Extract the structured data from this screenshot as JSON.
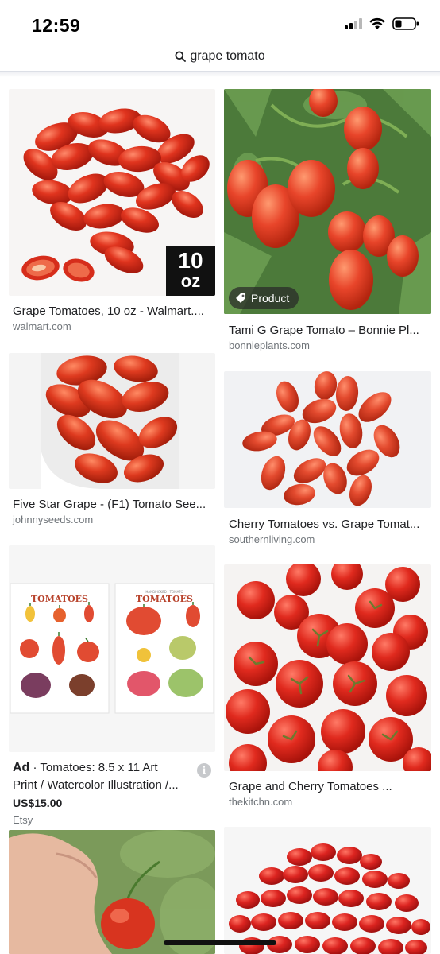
{
  "status_bar": {
    "time": "12:59",
    "battery_level": 0.35
  },
  "search": {
    "query": "grape tomato",
    "icon": "search-icon"
  },
  "results": [
    {
      "title": "Grape Tomatoes, 10 oz - Walmart....",
      "source": "walmart.com",
      "badge": {
        "number": "10",
        "unit": "oz"
      }
    },
    {
      "title": "Tami G Grape Tomato – Bonnie Pl...",
      "source": "bonnieplants.com",
      "chip": "Product",
      "chip_icon": "tag-icon"
    },
    {
      "title": "Five Star Grape - (F1) Tomato See...",
      "source": "johnnyseeds.com"
    },
    {
      "title": "Cherry Tomatoes vs. Grape Tomat...",
      "source": "southernliving.com"
    },
    {
      "title": "Grape and Cherry Tomatoes ...",
      "source": "thekitchn.com"
    }
  ],
  "ad": {
    "label": "Ad",
    "separator": "·",
    "title_line1": "Tomatoes: 8.5 x 11 Art",
    "title_line2": "Print / Watercolor Illustration /...",
    "price": "US$15.00",
    "seller": "Etsy",
    "info_icon": "i",
    "poster_headings": [
      "TOMATOES",
      "TOMATOES"
    ],
    "poster_subheading": "HANDPICKED · TOMATO"
  },
  "colors": {
    "tomato": "#d93a25",
    "tomato_dark": "#b52414",
    "leaf": "#3f7a2e",
    "source_grey": "#70757a"
  }
}
